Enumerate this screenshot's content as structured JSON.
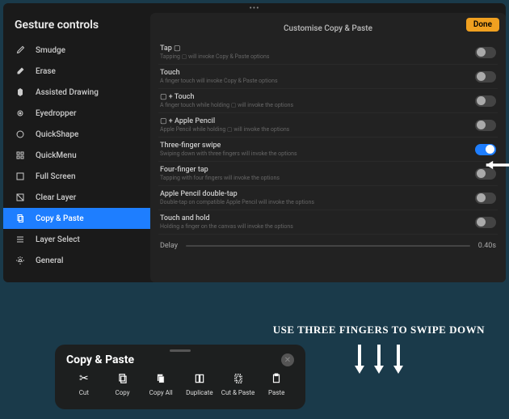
{
  "header": {
    "title": "Gesture controls",
    "main_title": "Customise Copy & Paste",
    "done": "Done"
  },
  "sidebar": {
    "items": [
      {
        "label": "Smudge"
      },
      {
        "label": "Erase"
      },
      {
        "label": "Assisted Drawing"
      },
      {
        "label": "Eyedropper"
      },
      {
        "label": "QuickShape"
      },
      {
        "label": "QuickMenu"
      },
      {
        "label": "Full Screen"
      },
      {
        "label": "Clear Layer"
      },
      {
        "label": "Copy & Paste"
      },
      {
        "label": "Layer Select"
      },
      {
        "label": "General"
      }
    ]
  },
  "options": [
    {
      "title": "Tap ▢",
      "sub": "Tapping ▢ will invoke Copy & Paste options",
      "on": false
    },
    {
      "title": "Touch",
      "sub": "A finger touch will invoke Copy & Paste options",
      "on": false
    },
    {
      "title": "▢ + Touch",
      "sub": "A finger touch while holding ▢ will invoke the options",
      "on": false
    },
    {
      "title": "▢ + Apple Pencil",
      "sub": "Apple Pencil while holding ▢ will invoke the options",
      "on": false
    },
    {
      "title": "Three-finger swipe",
      "sub": "Swiping down with three fingers will invoke the options",
      "on": true
    },
    {
      "title": "Four-finger tap",
      "sub": "Tapping with four fingers will invoke the options",
      "on": false
    },
    {
      "title": "Apple Pencil double-tap",
      "sub": "Double-tap on compatible Apple Pencil will invoke the options",
      "on": false
    },
    {
      "title": "Touch and hold",
      "sub": "Holding a finger on the canvas will invoke the options",
      "on": false
    }
  ],
  "delay": {
    "label": "Delay",
    "value": "0.40s"
  },
  "annotation": {
    "text": "USE THREE FINGERS TO SWIPE DOWN"
  },
  "popup": {
    "title": "Copy & Paste",
    "items": [
      {
        "label": "Cut"
      },
      {
        "label": "Copy"
      },
      {
        "label": "Copy All"
      },
      {
        "label": "Duplicate"
      },
      {
        "label": "Cut & Paste"
      },
      {
        "label": "Paste"
      }
    ]
  }
}
